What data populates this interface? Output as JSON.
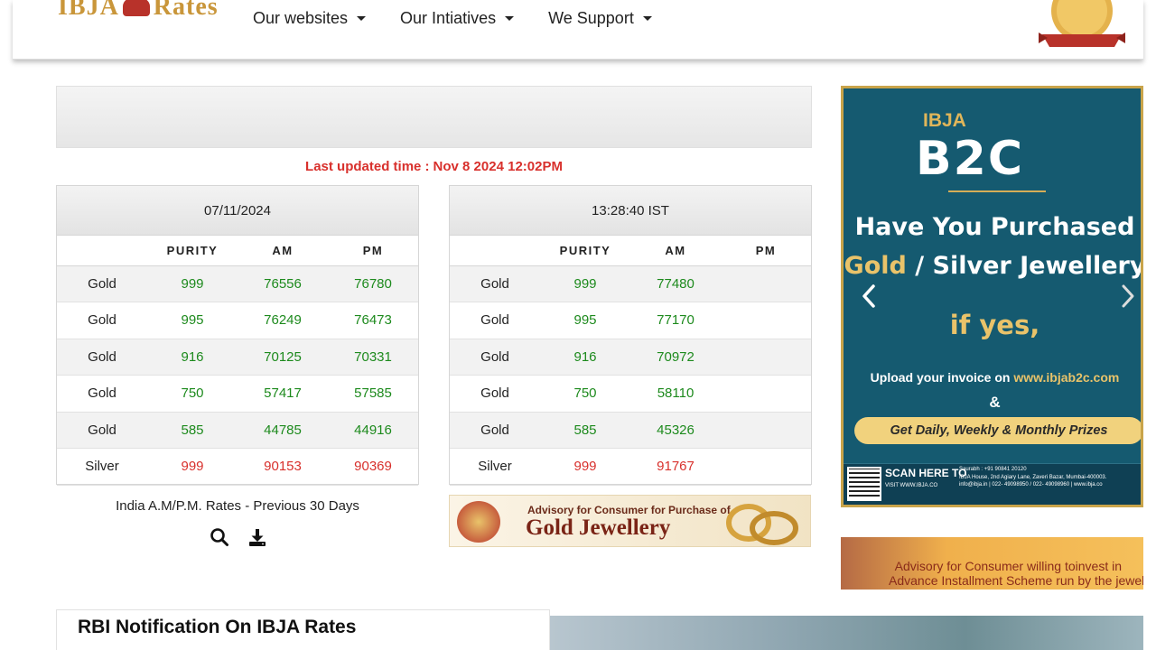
{
  "header": {
    "logo_text": "IBJA Rates",
    "nav": [
      {
        "label": "Our websites"
      },
      {
        "label": "Our Intiatives"
      },
      {
        "label": "We Support"
      }
    ]
  },
  "last_updated": {
    "label": "Last updated time :",
    "value": "Nov 8 2024 12:02PM"
  },
  "table_left": {
    "heading": "07/11/2024",
    "columns": [
      "",
      "PURITY",
      "AM",
      "PM"
    ],
    "rows": [
      {
        "metal": "Gold",
        "purity": "999",
        "am": "76556",
        "pm": "76780"
      },
      {
        "metal": "Gold",
        "purity": "995",
        "am": "76249",
        "pm": "76473"
      },
      {
        "metal": "Gold",
        "purity": "916",
        "am": "70125",
        "pm": "70331"
      },
      {
        "metal": "Gold",
        "purity": "750",
        "am": "57417",
        "pm": "57585"
      },
      {
        "metal": "Gold",
        "purity": "585",
        "am": "44785",
        "pm": "44916"
      },
      {
        "metal": "Silver",
        "purity": "999",
        "am": "90153",
        "pm": "90369"
      }
    ]
  },
  "table_right": {
    "heading": "13:28:40 IST",
    "columns": [
      "",
      "PURITY",
      "AM",
      "PM"
    ],
    "rows": [
      {
        "metal": "Gold",
        "purity": "999",
        "am": "77480",
        "pm": ""
      },
      {
        "metal": "Gold",
        "purity": "995",
        "am": "77170",
        "pm": ""
      },
      {
        "metal": "Gold",
        "purity": "916",
        "am": "70972",
        "pm": ""
      },
      {
        "metal": "Gold",
        "purity": "750",
        "am": "58110",
        "pm": ""
      },
      {
        "metal": "Gold",
        "purity": "585",
        "am": "45326",
        "pm": ""
      },
      {
        "metal": "Silver",
        "purity": "999",
        "am": "91767",
        "pm": ""
      }
    ]
  },
  "previous_rates": {
    "label": "India A.M/P.M. Rates - Previous 30 Days",
    "icons": [
      "search-icon",
      "download-icon"
    ]
  },
  "advisory_gold": {
    "line1": "Advisory for Consumer for Purchase of",
    "line2": "Gold Jewellery"
  },
  "ad_b2c": {
    "brand": "IBJA",
    "logo": "B2C",
    "headline1": "Have You Purchased",
    "headline2_gold": "Gold",
    "headline2_rest": "/ Silver Jewellery",
    "if_yes": "if yes,",
    "upload_text": "Upload your invoice on",
    "upload_url": "www.ibjab2c.com",
    "amp": "&",
    "prizes": "Get Daily, Weekly & Monthly Prizes",
    "scan": "SCAN HERE TO",
    "scan_sub": "VISIT WWW.IBJA.CO",
    "contact": "Saurabh : +91 90841 20120",
    "address": "IBJA House, 2nd Agiary Lane, Zaveri Bazar, Mumbai-400003.",
    "email": "info@ibja.in | 022- 49098950 / 022- 49098960 | www.ibja.co"
  },
  "advisory_scheme": {
    "line1": "Advisory for Consumer willing toinvest in",
    "line2": "Advance Installment Scheme run by the jewelle"
  },
  "rbi": {
    "title": "RBI Notification On IBJA Rates"
  },
  "colors": {
    "green": "#1d8a1d",
    "red": "#d8302c",
    "ad_teal": "#155a70",
    "ad_gold": "#e9c36a"
  }
}
